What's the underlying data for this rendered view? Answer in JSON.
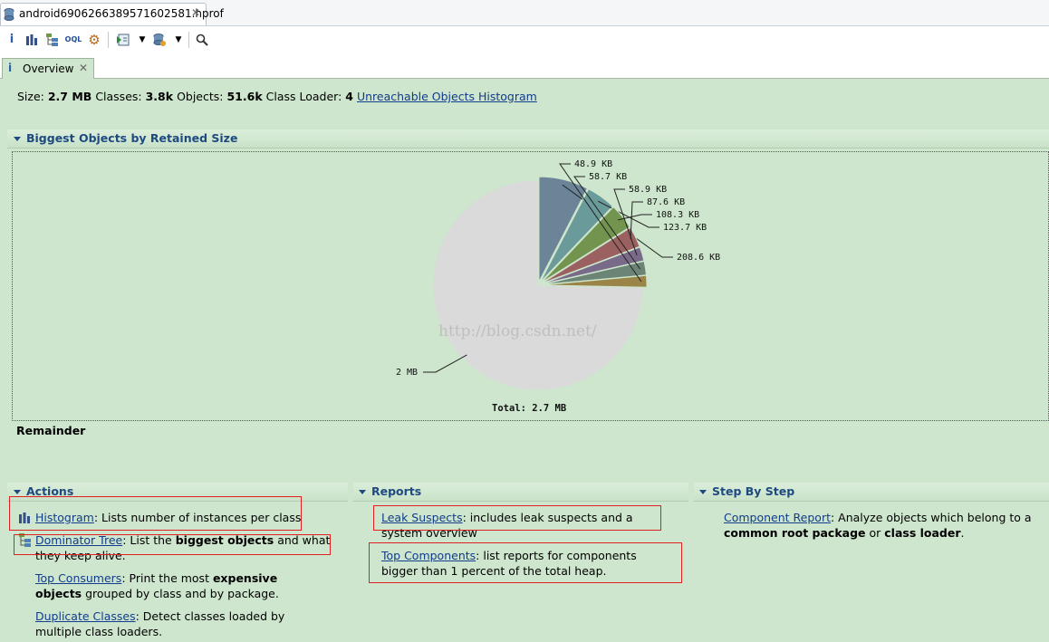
{
  "editor_tab": {
    "title": "android6906266389571602581.hprof",
    "close": "✕"
  },
  "overview_tab": {
    "label": "Overview",
    "close": "✕"
  },
  "summary": {
    "size_label": "Size:",
    "size_value": "2.7 MB",
    "classes_label": "Classes:",
    "classes_value": "3.8k",
    "objects_label": "Objects:",
    "objects_value": "51.6k",
    "loader_label": "Class Loader:",
    "loader_value": "4",
    "unreachable_link": "Unreachable Objects Histogram"
  },
  "biggest": {
    "title": "Biggest Objects by Retained Size",
    "total": "Total: 2.7 MB",
    "remainder": "Remainder",
    "watermark": "http://blog.csdn.net/"
  },
  "chart_data": {
    "type": "pie",
    "unit": "KB",
    "slices": [
      {
        "label": "208.6 KB",
        "value": 208.6,
        "color": "#6b8497"
      },
      {
        "label": "123.7 KB",
        "value": 123.7,
        "color": "#6a9a99"
      },
      {
        "label": "108.3 KB",
        "value": 108.3,
        "color": "#72944e"
      },
      {
        "label": "87.6 KB",
        "value": 87.6,
        "color": "#9b6060"
      },
      {
        "label": "58.9 KB",
        "value": 58.9,
        "color": "#7a6a8a"
      },
      {
        "label": "58.7 KB",
        "value": 58.7,
        "color": "#6c8476"
      },
      {
        "label": "48.9 KB",
        "value": 48.9,
        "color": "#9a8448"
      },
      {
        "label": "2 MB",
        "value": 2048,
        "color": "#dadada"
      }
    ],
    "total_label": "Total: 2.7 MB"
  },
  "actions": {
    "title": "Actions",
    "histogram_link": "Histogram",
    "histogram_text": ": Lists number of instances per class",
    "dominator_link": "Dominator Tree",
    "dominator_text1": ": List the ",
    "dominator_bold": "biggest objects",
    "dominator_text2": " and what they keep alive.",
    "consumers_link": "Top Consumers",
    "consumers_text1": ": Print the most ",
    "consumers_bold": "expensive objects",
    "consumers_text2": " grouped by class and by package.",
    "duplicate_link": "Duplicate Classes",
    "duplicate_text": ": Detect classes loaded by multiple class loaders."
  },
  "reports": {
    "title": "Reports",
    "leak_link": "Leak Suspects",
    "leak_text": ": includes leak suspects and a system overview",
    "top_link": "Top Components",
    "top_text": ": list reports for components bigger than 1 percent of the total heap."
  },
  "stepbystep": {
    "title": "Step By Step",
    "component_link": "Component Report",
    "component_text1": ": Analyze objects which belong to a ",
    "component_bold1": "common root package",
    "component_text2": " or ",
    "component_bold2": "class loader",
    "component_text3": "."
  },
  "icons": [
    "database-icon",
    "info-icon",
    "histogram-icon",
    "dominator-tree-icon",
    "oql-icon",
    "gear-icon",
    "run-report-icon",
    "heap-dump-icon",
    "search-icon"
  ]
}
